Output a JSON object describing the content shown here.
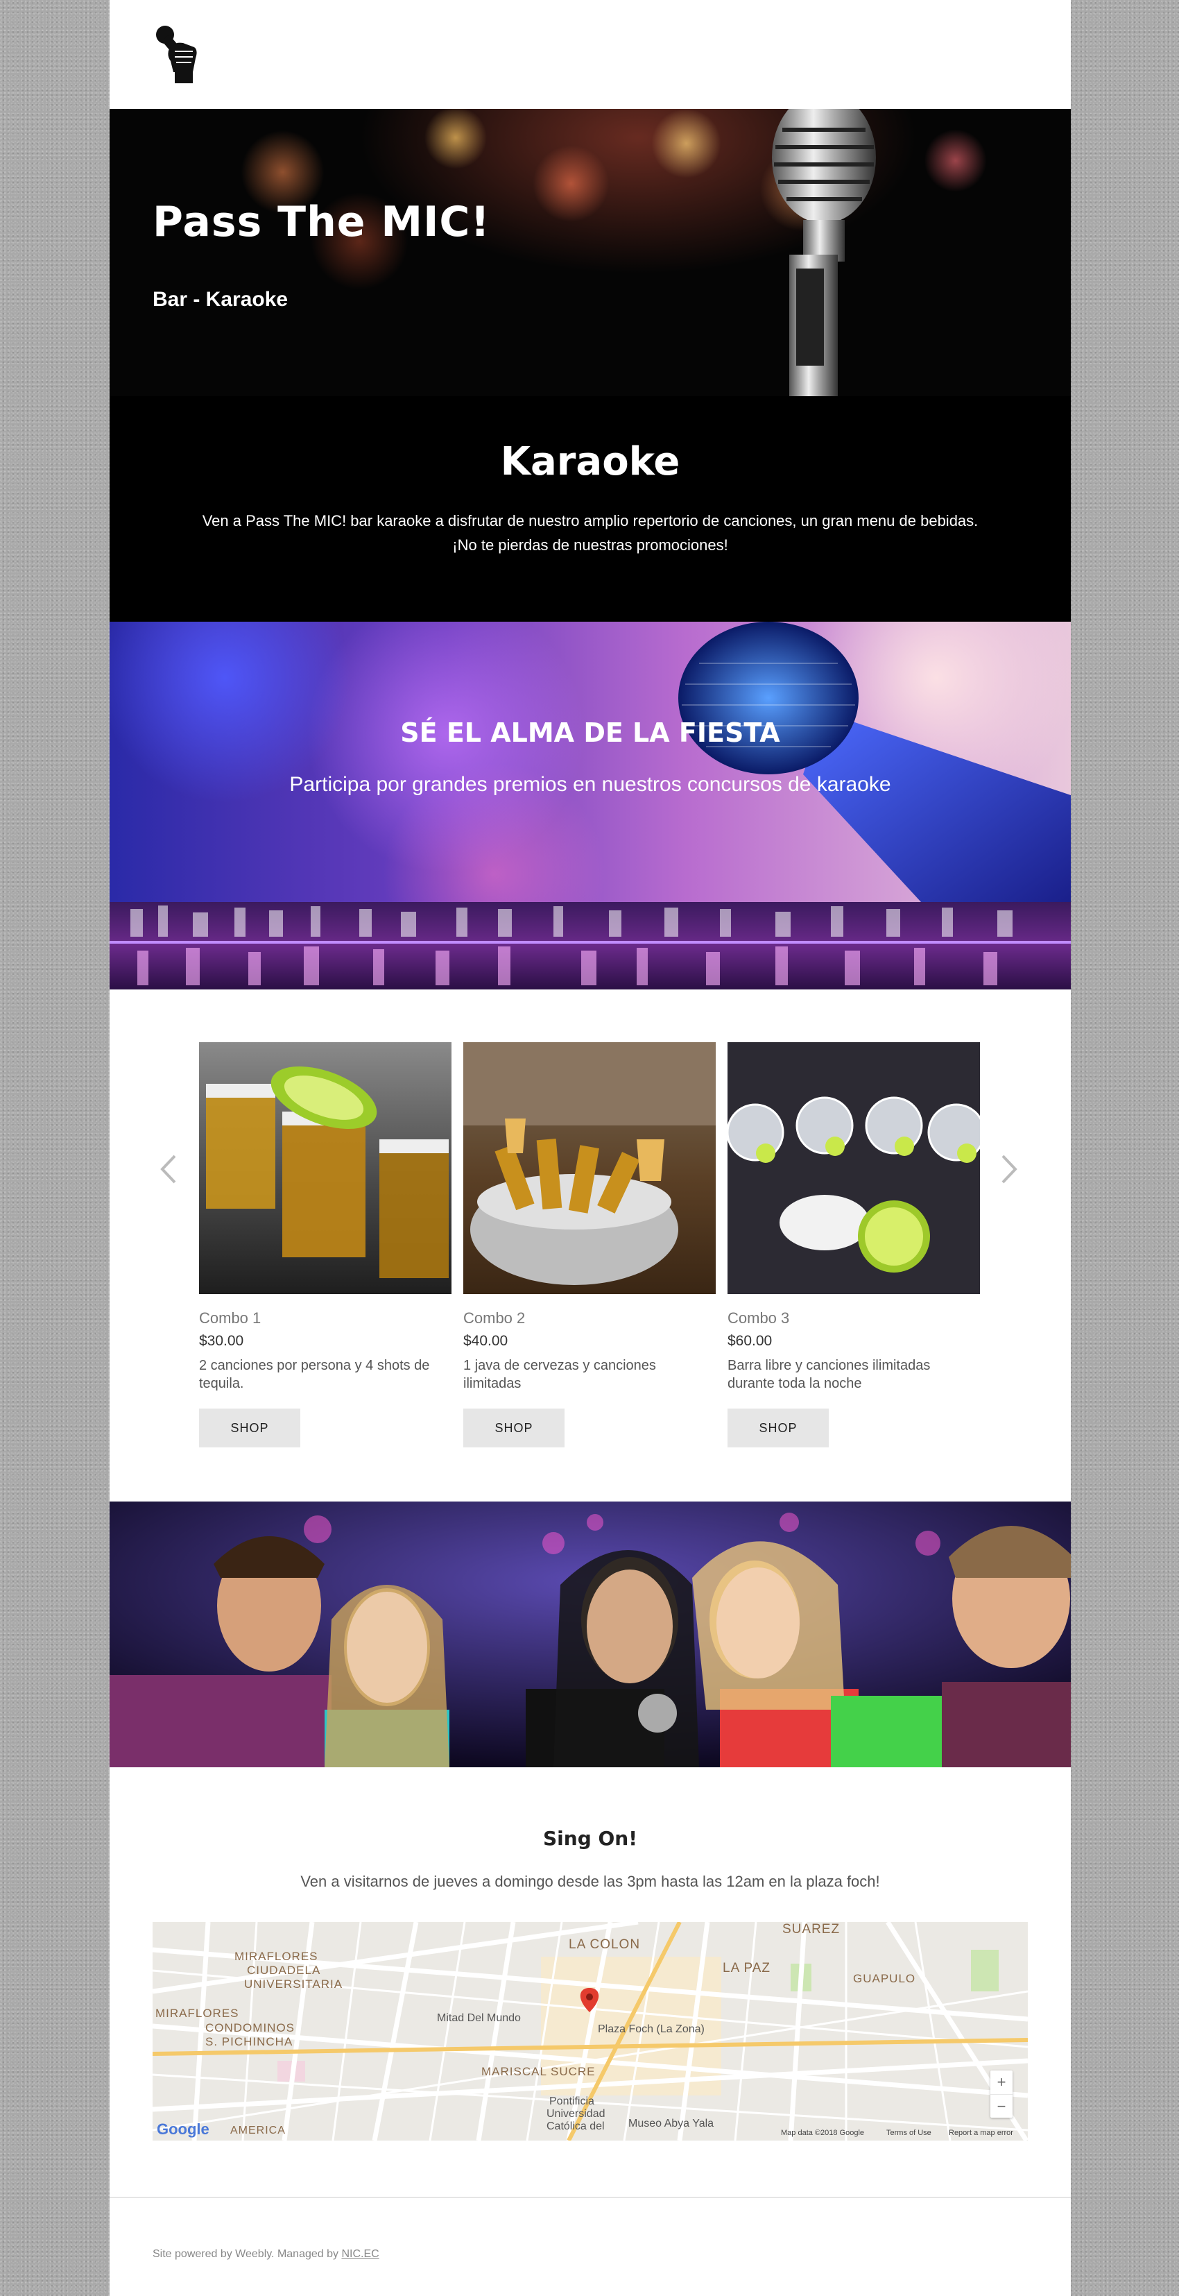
{
  "header": {
    "logo_icon": "microphone-fist-icon"
  },
  "hero": {
    "title": "Pass The MIC!",
    "subtitle": "Bar - Karaoke"
  },
  "karaoke": {
    "title": "Karaoke",
    "line1": "Ven a Pass The MIC! bar karaoke a disfrutar de nuestro amplio repertorio de canciones, un gran menu de bebidas.",
    "line2": "¡No te pierdas de nuestras promociones!"
  },
  "party": {
    "title": "SÉ EL ALMA DE LA FIESTA",
    "subtitle": "Participa por grandes premios en nuestros concursos de karaoke"
  },
  "products": {
    "prev_icon": "chevron-left-icon",
    "next_icon": "chevron-right-icon",
    "items": [
      {
        "name": "Combo 1",
        "price": "$30.00",
        "desc_line1": "2 canciones por persona y 4 shots de",
        "desc_line2": "tequila.",
        "button": "SHOP"
      },
      {
        "name": "Combo 2",
        "price": "$40.00",
        "desc_line1": "1 java de cervezas y canciones",
        "desc_line2": "ilimitadas",
        "button": "SHOP"
      },
      {
        "name": "Combo 3",
        "price": "$60.00",
        "desc_line1": "Barra libre y canciones ilimitadas",
        "desc_line2": "durante toda la noche",
        "button": "SHOP"
      }
    ]
  },
  "singon": {
    "title": "Sing On!",
    "text": "Ven a visitarnos de jueves a domingo desde las 3pm hasta las 12am en la plaza foch!"
  },
  "map": {
    "labels": {
      "miraflores": "MIRAFLORES",
      "ciudadela": "CIUDADELA",
      "universitaria": "UNIVERSITARIA",
      "miraflores2": "MIRAFLORES",
      "condominos": "CONDOMINOS",
      "pichincha": "S. PICHINCHA",
      "la_colon": "LA COLON",
      "la_paz": "LA PAZ",
      "suarez": "SUAREZ",
      "guapulo": "GUAPULO",
      "mitad": "Mitad Del Mundo",
      "plaza": "Plaza Foch (La Zona)",
      "mariscal": "MARISCAL SUCRE",
      "pontificia": "Pontificia",
      "universidad": "Universidad",
      "catolica": "Católica del",
      "museo": "Museo Abya Yala",
      "america": "AMERICA",
      "google": "Google",
      "map_data": "Map data ©2018 Google",
      "terms": "Terms of Use",
      "report": "Report a map error",
      "zoom_in": "+",
      "zoom_out": "−"
    }
  },
  "footer": {
    "text": "Site powered by Weebly. Managed by ",
    "link": "NIC.EC"
  }
}
